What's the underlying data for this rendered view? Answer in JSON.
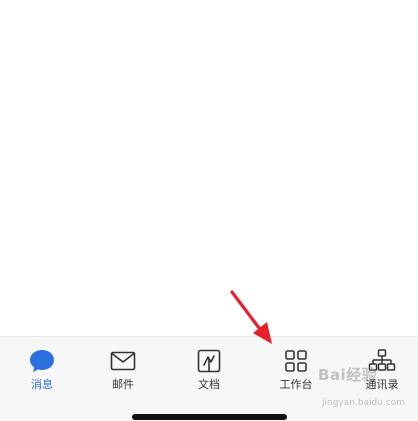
{
  "tabbar": {
    "tabs": [
      {
        "label": "消息",
        "icon": "chat-bubble-icon",
        "active": true
      },
      {
        "label": "邮件",
        "icon": "mail-icon",
        "active": false
      },
      {
        "label": "文档",
        "icon": "document-icon",
        "active": false
      },
      {
        "label": "工作台",
        "icon": "grid-apps-icon",
        "active": false
      },
      {
        "label": "通讯录",
        "icon": "org-chart-icon",
        "active": false
      }
    ]
  },
  "watermark": {
    "logo": "Bai经验",
    "url": "jingyan.baidu.com"
  },
  "colors": {
    "active": "#2e6fe0",
    "inactive_icon": "#333333",
    "arrow": "#e8202a",
    "tabbar_bg": "#f7f7f8"
  }
}
